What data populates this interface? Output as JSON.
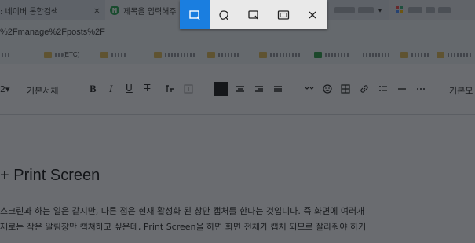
{
  "browser": {
    "tabs": [
      {
        "label": ": 네이버 통합검색",
        "close": "×"
      },
      {
        "favicon": "N",
        "label": "제목을 입력해주"
      },
      {
        "label": ""
      },
      {
        "label": ""
      }
    ],
    "tab_dropdown": "▾",
    "url": "%2Fmanage%2Fposts%2F",
    "bookmarks": [
      {
        "label": "(ETC)"
      }
    ]
  },
  "editor": {
    "toolbar": {
      "font_size": "2▾",
      "font_family": "기본서체",
      "bold": "B",
      "italic": "I",
      "underline": "U",
      "strike": "T",
      "right_label": "기본모"
    },
    "heading": "+  Print Screen",
    "paragraphs": [
      "스크린과 하는 일은 같지만, 다른 점은 현재 활성화 된 창만 캡처를 한다는 것입니다. 즉 화면에 여러개",
      "재로는 작은 알림창만 캡쳐하고 싶은데,  Print Screen을 하면 화면 전체가 캡처 되므로 잘라줘야 하거"
    ]
  },
  "snipping_toolbar": {
    "modes": [
      {
        "name": "rectangular-snip",
        "icon": "rectangle-snip-icon",
        "active": true
      },
      {
        "name": "freeform-snip",
        "icon": "freeform-snip-icon",
        "active": false
      },
      {
        "name": "window-snip",
        "icon": "window-snip-icon",
        "active": false
      },
      {
        "name": "fullscreen-snip",
        "icon": "fullscreen-snip-icon",
        "active": false
      },
      {
        "name": "close",
        "icon": "close-icon",
        "active": false
      }
    ],
    "accent": "#1a7ee0"
  }
}
